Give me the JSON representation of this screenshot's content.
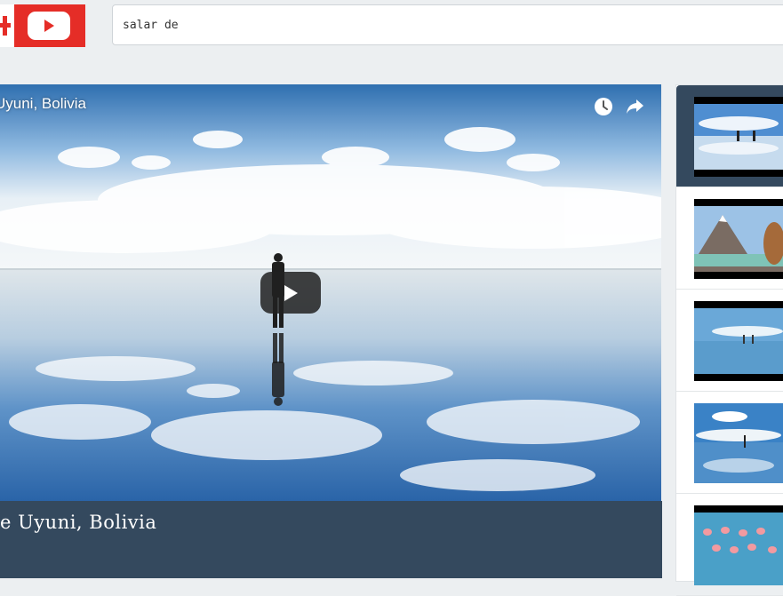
{
  "header": {
    "logo_icon": "youtube-plus-logo",
    "search": {
      "value": "salar de",
      "placeholder": ""
    }
  },
  "player": {
    "overlay_title": "Uyuni, Bolivia",
    "watch_later_icon": "clock-icon",
    "share_icon": "share-arrow-icon",
    "play_icon": "play-icon"
  },
  "video": {
    "title": "e Uyuni, Bolivia"
  },
  "sidebar": {
    "items": [
      {
        "thumb": "salt-flat-reflection-people",
        "active": true
      },
      {
        "thumb": "volcano-lagoon-woman",
        "active": false
      },
      {
        "thumb": "salt-flat-distant-people",
        "active": false
      },
      {
        "thumb": "salt-flat-single-person",
        "active": false
      },
      {
        "thumb": "flamingos-lagoon",
        "active": false
      }
    ]
  },
  "colors": {
    "brand_red": "#e52d27",
    "info_bar": "#34495e",
    "page_bg": "#eceff1"
  }
}
